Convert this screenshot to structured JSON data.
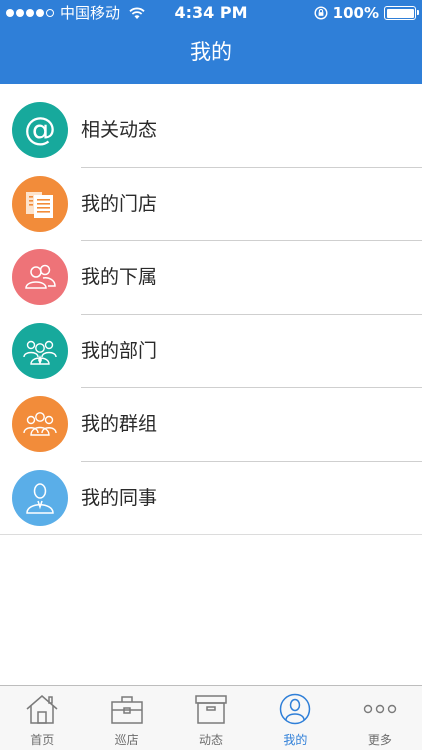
{
  "status_bar": {
    "carrier": "中国移动",
    "time": "4:34 PM",
    "battery": "100%",
    "battery_level": 1.0
  },
  "nav": {
    "title": "我的"
  },
  "colors": {
    "header": "#2f7fd8",
    "teal": "#17a99c",
    "orange": "#f28c3a",
    "coral": "#ee7378",
    "blue": "#5aaee8",
    "tab_active": "#2f7fd8"
  },
  "menu": {
    "items": [
      {
        "label": "相关动态",
        "icon": "at-sign-icon",
        "color": "#17a99c"
      },
      {
        "label": "我的门店",
        "icon": "documents-icon",
        "color": "#f28c3a"
      },
      {
        "label": "我的下属",
        "icon": "two-people-icon",
        "color": "#ee7378"
      },
      {
        "label": "我的部门",
        "icon": "team-icon",
        "color": "#17a99c"
      },
      {
        "label": "我的群组",
        "icon": "group-icon",
        "color": "#f28c3a"
      },
      {
        "label": "我的同事",
        "icon": "colleague-icon",
        "color": "#5aaee8"
      }
    ]
  },
  "tab_bar": {
    "tabs": [
      {
        "label": "首页",
        "icon": "home-icon",
        "active": false
      },
      {
        "label": "巡店",
        "icon": "briefcase-icon",
        "active": false
      },
      {
        "label": "动态",
        "icon": "archive-box-icon",
        "active": false
      },
      {
        "label": "我的",
        "icon": "user-circle-icon",
        "active": true
      },
      {
        "label": "更多",
        "icon": "more-dots-icon",
        "active": false
      }
    ]
  }
}
